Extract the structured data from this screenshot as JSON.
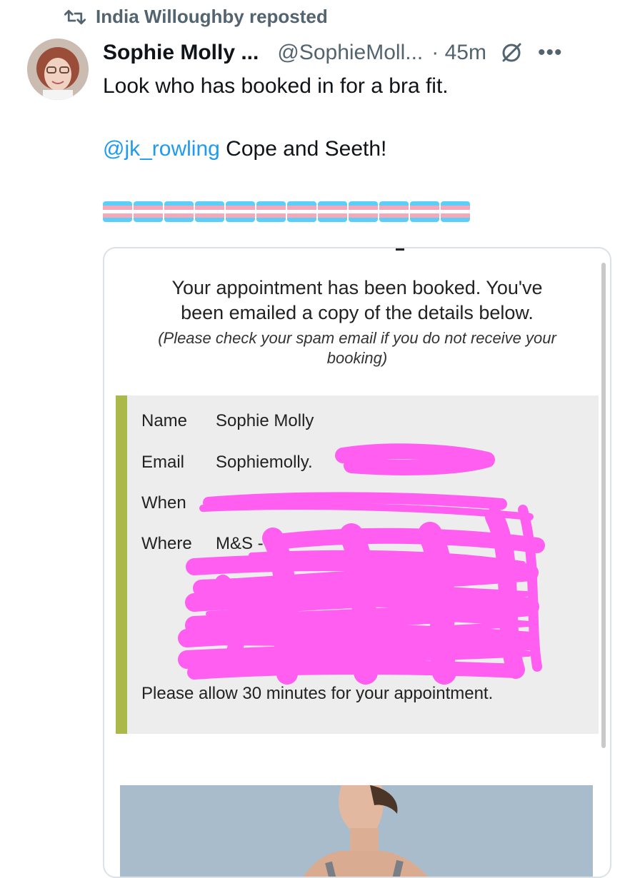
{
  "repost": {
    "text": "India Willoughby reposted"
  },
  "post": {
    "display_name": "Sophie Molly ...",
    "handle": "@SophieMoll...",
    "time": "· 45m",
    "line1": "Look who has booked in for a bra fit.",
    "mention": "@jk_rowling",
    "line2_rest": " Cope and Seeth!",
    "flag_count": 12
  },
  "booking": {
    "confirm_line1": "Your appointment has been booked. You've",
    "confirm_line2": "been emailed a copy of the details below.",
    "spam_line1": "(Please check your spam email if you do not receive your",
    "spam_line2": "booking)",
    "name_label": "Name",
    "name_value": "Sophie Molly",
    "email_label": "Email",
    "email_value": "Sophiemolly.",
    "when_label": "When",
    "where_label": "Where",
    "where_value": "M&S -",
    "allow_note": "Please allow 30 minutes for your appointment."
  },
  "colors": {
    "accent_blue": "#1d9bf0",
    "muted": "#536471",
    "flag_blue": "#5bcefa",
    "flag_pink": "#f5a9b8",
    "flag_white": "#ffffff",
    "detail_bar": "#aab94a",
    "redaction": "#ff5ef0"
  },
  "icons": {
    "repost": "repost-icon",
    "grok": "grok-icon",
    "more": "more-icon"
  }
}
